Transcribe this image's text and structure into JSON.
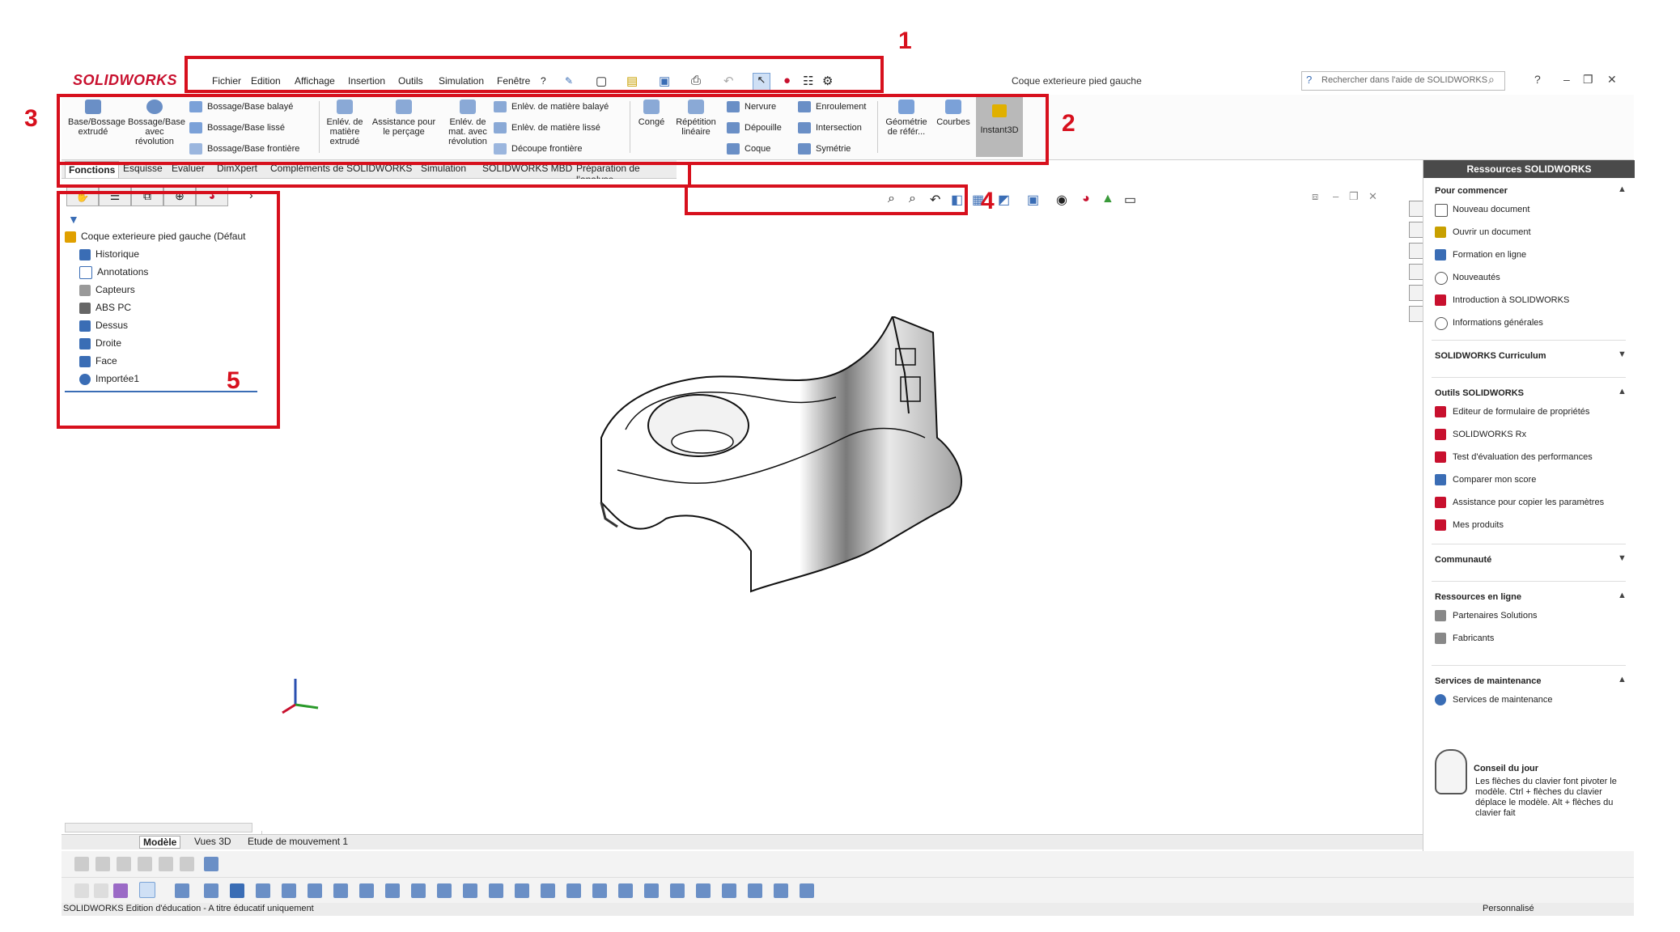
{
  "titlebar": {
    "logo": "SOLIDWORKS",
    "menu": [
      "Fichier",
      "Edition",
      "Affichage",
      "Insertion",
      "Outils",
      "Simulation",
      "Fenêtre",
      "?"
    ],
    "document_title": "Coque exterieure pied gauche",
    "search_placeholder": "Rechercher dans l'aide de SOLIDWORKS"
  },
  "commands": {
    "large": [
      "Base/Bossage extrudé",
      "Bossage/Base avec révolution",
      "Enlév. de matière extrudé",
      "Assistance pour le perçage",
      "Enlév. de mat. avec révolution",
      "Congé",
      "Répétition linéaire",
      "Géométrie de référ...",
      "Courbes",
      "Instant3D"
    ],
    "small": [
      "Bossage/Base balayé",
      "Bossage/Base lissé",
      "Bossage/Base frontière",
      "Enlèv. de matière balayé",
      "Enlèv. de matière lissé",
      "Découpe frontière",
      "Nervure",
      "Dépouille",
      "Coque",
      "Enroulement",
      "Intersection",
      "Symétrie"
    ]
  },
  "tabs": [
    "Fonctions",
    "Esquisse",
    "Evaluer",
    "DimXpert",
    "Compléments de SOLIDWORKS",
    "Simulation",
    "SOLIDWORKS MBD",
    "Préparation de l'analyse"
  ],
  "tree": {
    "root": "Coque exterieure pied gauche  (Défaut",
    "items": [
      "Historique",
      "Annotations",
      "Capteurs",
      "ABS PC",
      "Dessus",
      "Droite",
      "Face",
      "Importée1"
    ]
  },
  "taskpane": {
    "title": "Ressources SOLIDWORKS",
    "sections": {
      "pour_commencer": "Pour commencer",
      "curriculum": "SOLIDWORKS Curriculum",
      "outils": "Outils SOLIDWORKS",
      "communaute": "Communauté",
      "ressources": "Ressources en ligne",
      "services": "Services de maintenance"
    },
    "pour_commencer_items": [
      "Nouveau document",
      "Ouvrir un document",
      "Formation en ligne",
      "Nouveautés",
      "Introduction à SOLIDWORKS",
      "Informations générales"
    ],
    "outils_items": [
      "Editeur de formulaire de propriétés",
      "SOLIDWORKS Rx",
      "Test d'évaluation des performances",
      "Comparer mon score",
      "Assistance pour copier les paramètres",
      "Mes produits"
    ],
    "ressources_items": [
      "Partenaires Solutions",
      "Fabricants"
    ],
    "services_items": [
      "Services de maintenance"
    ],
    "conseil_title": "Conseil du jour",
    "conseil_text": "Les flèches du clavier font pivoter le modèle. Ctrl + flèches du clavier déplace le modèle. Alt + flèches du clavier fait"
  },
  "bottom_tabs": [
    "Modèle",
    "Vues 3D",
    "Etude de mouvement 1"
  ],
  "status": {
    "left": "SOLIDWORKS Edition d'éducation - A titre éducatif uniquement",
    "right": "Personnalisé"
  },
  "annotations": [
    "1",
    "2",
    "3",
    "4",
    "5"
  ],
  "colors": {
    "annotation_red": "#d7101d",
    "brand_red": "#c8102e"
  }
}
